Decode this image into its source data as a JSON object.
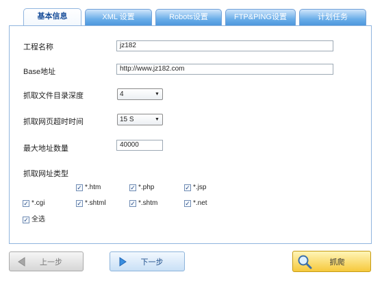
{
  "tabs": [
    {
      "label": "基本信息"
    },
    {
      "label": "XML 设置"
    },
    {
      "label": "Robots设置"
    },
    {
      "label": "FTP&PING设置"
    },
    {
      "label": "计划任务"
    }
  ],
  "form": {
    "project_name": {
      "label": "工程名称",
      "value": "jz182"
    },
    "base_url": {
      "label": "Base地址",
      "value": "http://www.jz182.com"
    },
    "crawl_depth": {
      "label": "抓取文件目录深度",
      "value": "4"
    },
    "timeout": {
      "label": "抓取网页超时时间",
      "value": "15 S"
    },
    "max_urls": {
      "label": "最大地址数量",
      "value": "40000"
    },
    "url_types_label": "抓取网址类型",
    "url_types": [
      {
        "label": "*.htm",
        "checked": true
      },
      {
        "label": "*.php",
        "checked": true
      },
      {
        "label": "*.jsp",
        "checked": true
      },
      {
        "label": "*.cgi",
        "checked": true
      },
      {
        "label": "*.shtml",
        "checked": true
      },
      {
        "label": "*.shtm",
        "checked": true
      },
      {
        "label": "*.net",
        "checked": true
      }
    ],
    "select_all": {
      "label": "全选",
      "checked": true
    }
  },
  "buttons": {
    "prev": "上一步",
    "next": "下一步",
    "crawl": "抓爬"
  },
  "check_mark": "✓",
  "dropdown_arrow": "▼",
  "colors": {
    "tab_blue": "#5aa2e3",
    "panel_border": "#8fb4de",
    "crawl_yellow": "#f6c93c"
  }
}
